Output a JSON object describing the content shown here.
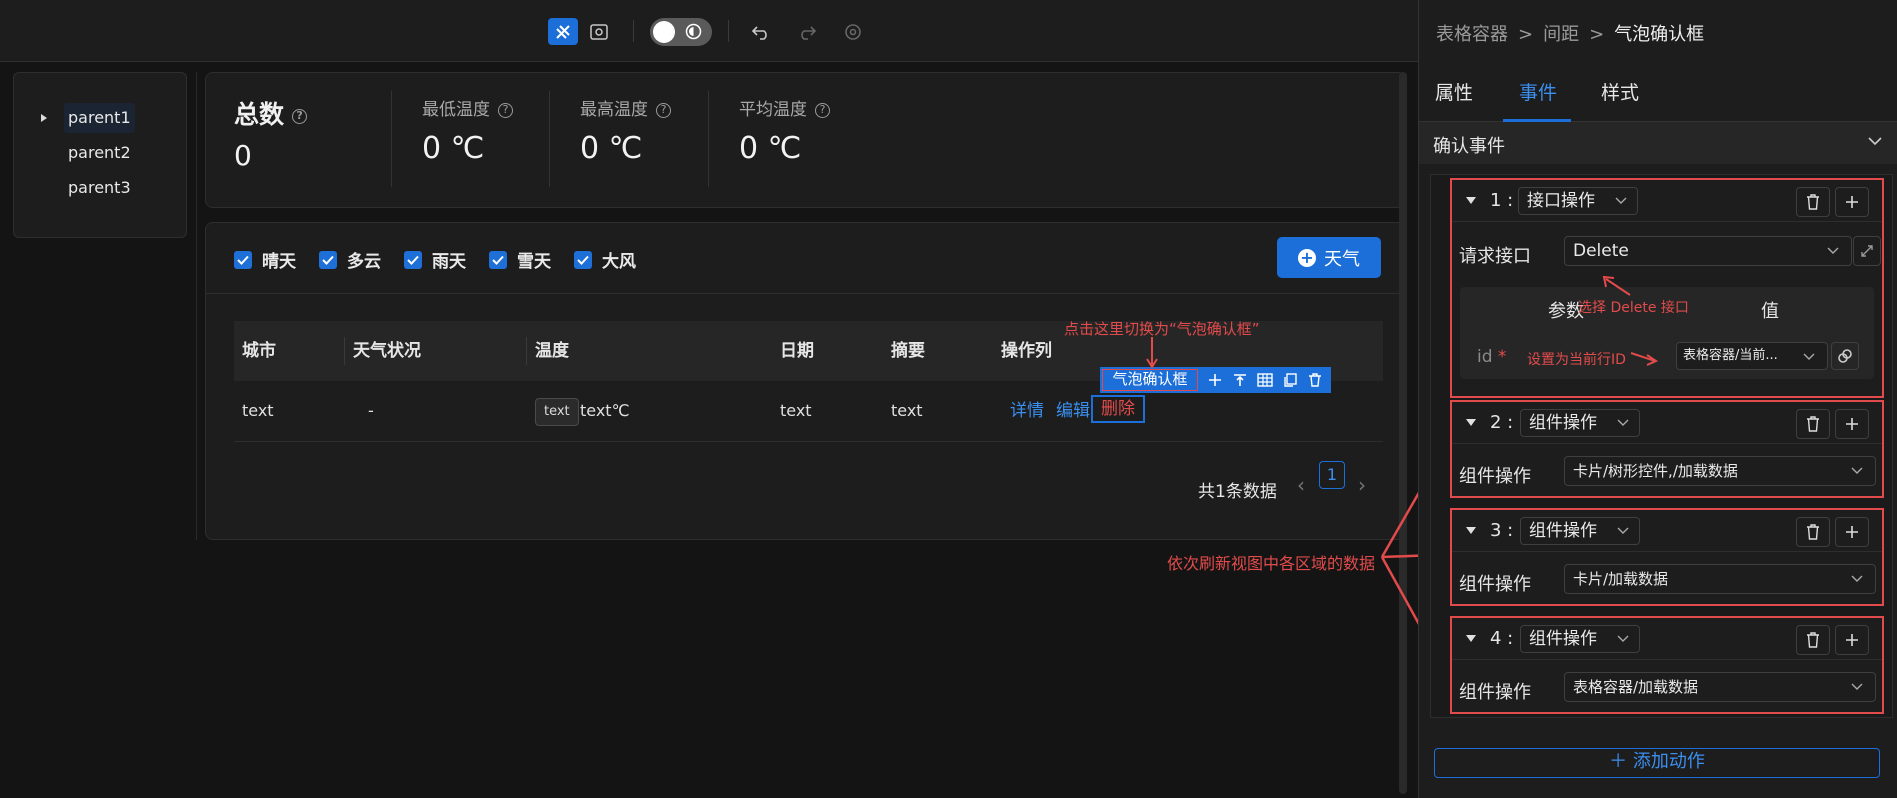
{
  "toolbar": {
    "buttons": [
      "design-mode",
      "preview",
      "theme-toggle",
      "undo",
      "redo",
      "history"
    ]
  },
  "tree": {
    "items": [
      "parent1",
      "parent2",
      "parent3"
    ],
    "selected": "parent1"
  },
  "stats": {
    "total_label": "总数",
    "total_value": "0",
    "min_temp_label": "最低温度",
    "min_temp_value": "0 ℃",
    "max_temp_label": "最高温度",
    "max_temp_value": "0 ℃",
    "avg_temp_label": "平均温度",
    "avg_temp_value": "0 ℃",
    "help_glyph": "?"
  },
  "filters": {
    "options": [
      "晴天",
      "多云",
      "雨天",
      "雪天",
      "大风"
    ],
    "add_button": "天气",
    "add_icon": "+"
  },
  "table": {
    "columns": [
      "城市",
      "天气状况",
      "温度",
      "日期",
      "摘要",
      "操作列"
    ],
    "row": {
      "city": "text",
      "weather": "-",
      "temp_tag": "text",
      "temp": "text℃",
      "date": "text",
      "summary": "text",
      "action_detail": "详情",
      "action_edit": "编辑",
      "action_delete": "删除"
    },
    "pager_total": "共1条数据",
    "pager_current": "1",
    "pager_prev": "‹",
    "pager_next": "›"
  },
  "selection_toolbar": {
    "label": "气泡确认框",
    "icons": [
      "move-icon",
      "align-top-icon",
      "table-icon",
      "copy-icon",
      "delete-icon"
    ]
  },
  "annotations": {
    "switch_hint": "点击这里切换为“气泡确认框”",
    "select_api_hint": "选择 Delete 接口",
    "set_id_hint": "设置为当前行ID",
    "refresh_hint": "依次刷新视图中各区域的数据"
  },
  "panel": {
    "breadcrumb": [
      "表格容器",
      "间距",
      "气泡确认框"
    ],
    "breadcrumb_sep": ">",
    "tabs": [
      "属性",
      "事件",
      "样式"
    ],
    "active_tab": "事件",
    "section_title": "确认事件",
    "actions": [
      {
        "index": "1 :",
        "type": "接口操作",
        "field_label": "请求接口",
        "field_value": "Delete",
        "params_header": "参数",
        "value_header": "值",
        "param_name": "id",
        "required_mark": "*",
        "param_value": "表格容器/当前..."
      },
      {
        "index": "2 :",
        "type": "组件操作",
        "field_label": "组件操作",
        "field_value": "卡片/树形控件,/加载数据"
      },
      {
        "index": "3 :",
        "type": "组件操作",
        "field_label": "组件操作",
        "field_value": "卡片/加载数据"
      },
      {
        "index": "4 :",
        "type": "组件操作",
        "field_label": "组件操作",
        "field_value": "表格容器/加载数据"
      }
    ],
    "add_action": "＋ 添加动作"
  },
  "colors": {
    "accent": "#1c6fd9",
    "link": "#3b8ff0",
    "annotation": "#e24b4b",
    "background": "#141414",
    "surface": "#1d1d1d"
  }
}
